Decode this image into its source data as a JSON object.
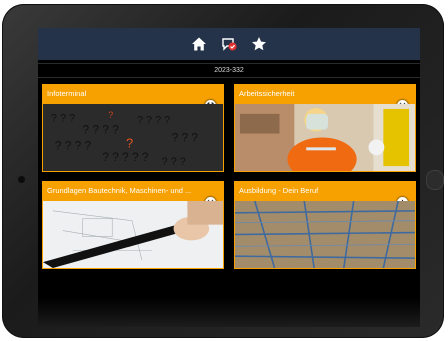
{
  "header": {
    "icons": [
      "home-icon",
      "chat-check-icon",
      "star-icon"
    ],
    "date_code": "2023-332"
  },
  "tiles": [
    {
      "title": "Infoterminal",
      "image": "dark-question-marks-image"
    },
    {
      "title": "Arbeitssicherheit",
      "image": "worker-safety-image"
    },
    {
      "title": "Grundlagen Bautechnik, Maschinen- und ...",
      "image": "technical-drawing-image"
    },
    {
      "title": "Ausbildung - Dein Beruf",
      "image": "rebar-construction-image"
    }
  ],
  "colors": {
    "topbar": "#25334a",
    "accent": "#f6a100",
    "screen_bg": "#000000"
  }
}
